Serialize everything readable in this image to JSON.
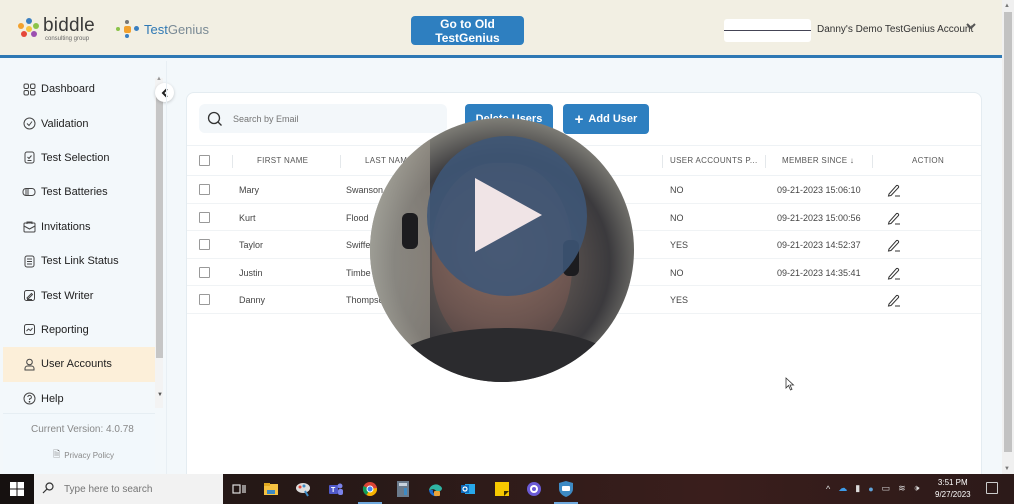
{
  "header": {
    "brand_name": "biddle",
    "brand_sub": "consulting group",
    "product_name_1": "Test",
    "product_name_2": "Genius",
    "old_button": "Go to Old TestGenius",
    "account_name": "Danny's Demo TestGenius Account",
    "account_chevron": "chevron-down-icon",
    "brand_color": "#2e7fc0"
  },
  "sidebar": {
    "items": [
      {
        "label": "Dashboard",
        "icon": "dashboard-grid-icon",
        "active": false
      },
      {
        "label": "Validation",
        "icon": "check-circle-icon",
        "active": false
      },
      {
        "label": "Test Selection",
        "icon": "clipboard-icon",
        "active": false
      },
      {
        "label": "Test Batteries",
        "icon": "battery-icon",
        "active": false
      },
      {
        "label": "Invitations",
        "icon": "envelope-icon",
        "active": false
      },
      {
        "label": "Test Link Status",
        "icon": "list-icon",
        "active": false
      },
      {
        "label": "Test Writer",
        "icon": "pen-square-icon",
        "active": false
      },
      {
        "label": "Reporting",
        "icon": "chart-line-icon",
        "active": false
      },
      {
        "label": "User Accounts",
        "icon": "user-icon",
        "active": true
      },
      {
        "label": "Help",
        "icon": "help-circle-icon",
        "active": false
      }
    ],
    "version": "Current Version: 4.0.78",
    "privacy": "Privacy Policy",
    "collapse_icon": "chevron-left-icon"
  },
  "toolbar": {
    "search_placeholder": "Search by Email",
    "delete_label": "Delete Users",
    "add_label": "Add User",
    "add_icon": "+"
  },
  "table": {
    "columns": [
      "FIRST NAME",
      "LAST NAME",
      "",
      "USER ACCOUNTS P...",
      "MEMBER SINCE",
      "ACTION"
    ],
    "sort_indicator": "↓",
    "rows": [
      {
        "first": "Mary",
        "last": "Swanson",
        "user_accounts": "NO",
        "member_since": "09-21-2023 15:06:10"
      },
      {
        "first": "Kurt",
        "last": "Flood",
        "user_accounts": "NO",
        "member_since": "09-21-2023 15:00:56"
      },
      {
        "first": "Taylor",
        "last": "Swiffe",
        "user_accounts": "YES",
        "member_since": "09-21-2023 14:52:37"
      },
      {
        "first": "Justin",
        "last": "Timbe",
        "user_accounts": "NO",
        "member_since": "09-21-2023 14:35:41"
      },
      {
        "first": "Danny",
        "last": "Thompso",
        "user_accounts": "YES",
        "member_since": ""
      }
    ]
  },
  "video": {
    "play_icon": "play-icon"
  },
  "taskbar": {
    "search_placeholder": "Type here to search",
    "apps": [
      "task-view",
      "file-explorer",
      "paint",
      "teams",
      "chrome",
      "calculator",
      "edge",
      "outlook",
      "sticky-notes",
      "settings",
      "security"
    ],
    "time": "3:51 PM",
    "date": "9/27/2023"
  }
}
